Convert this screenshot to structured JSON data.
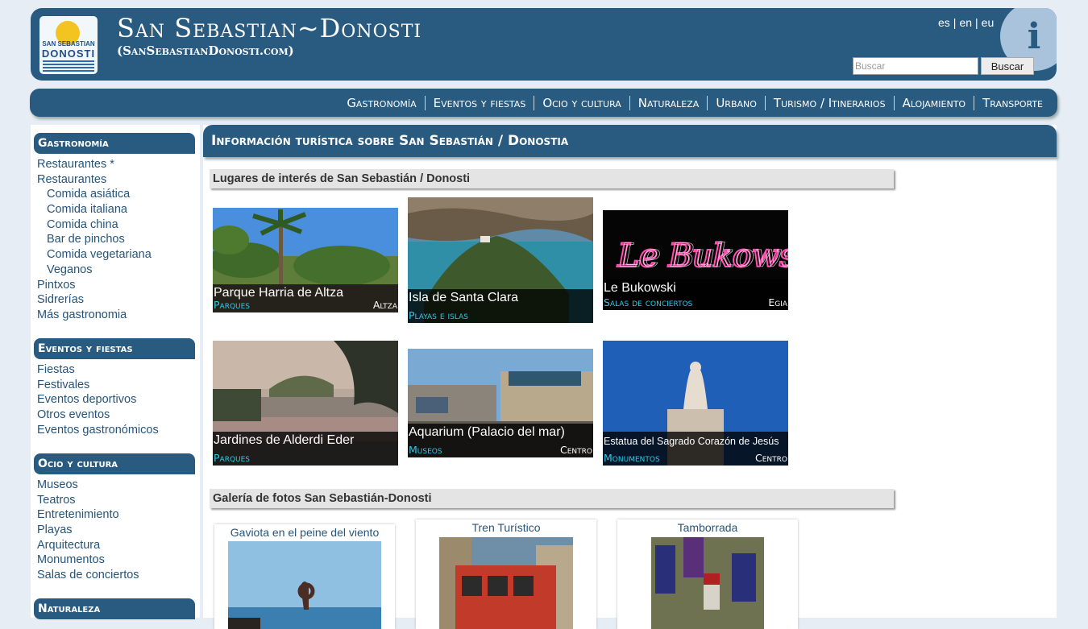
{
  "header": {
    "logo_line1": "SAN SEBASTIAN",
    "logo_line2": "DONOSTI",
    "title": "San Sebastian~Donosti",
    "subtitle": "(SanSebastianDonosti.com)",
    "languages": [
      "es",
      "en",
      "eu"
    ],
    "info_glyph": "i",
    "search_placeholder": "Buscar",
    "search_button": "Buscar"
  },
  "nav": [
    "Gastronomía",
    "Eventos y fiestas",
    "Ocio y cultura",
    "Naturaleza",
    "Urbano",
    "Turismo / Itinerarios",
    "Alojamiento",
    "Transporte"
  ],
  "sidebar": [
    {
      "title": "Gastronomía",
      "items": [
        {
          "label": "Restaurantes *",
          "sub": false
        },
        {
          "label": "Restaurantes",
          "sub": false
        },
        {
          "label": "Comida asiática",
          "sub": true
        },
        {
          "label": "Comida italiana",
          "sub": true
        },
        {
          "label": "Comida china",
          "sub": true
        },
        {
          "label": "Bar de pinchos",
          "sub": true
        },
        {
          "label": "Comida vegetariana",
          "sub": true
        },
        {
          "label": "Veganos",
          "sub": true
        },
        {
          "label": "Pintxos",
          "sub": false
        },
        {
          "label": "Sidrerías",
          "sub": false
        },
        {
          "label": "Más gastronomia",
          "sub": false
        }
      ]
    },
    {
      "title": "Eventos y fiestas",
      "items": [
        {
          "label": "Fiestas",
          "sub": false
        },
        {
          "label": "Festivales",
          "sub": false
        },
        {
          "label": "Eventos deportivos",
          "sub": false
        },
        {
          "label": "Otros eventos",
          "sub": false
        },
        {
          "label": "Eventos gastronómicos",
          "sub": false
        }
      ]
    },
    {
      "title": "Ocio y cultura",
      "items": [
        {
          "label": "Museos",
          "sub": false
        },
        {
          "label": "Teatros",
          "sub": false
        },
        {
          "label": "Entretenimiento",
          "sub": false
        },
        {
          "label": "Playas",
          "sub": false
        },
        {
          "label": "Arquitectura",
          "sub": false
        },
        {
          "label": "Monumentos",
          "sub": false
        },
        {
          "label": "Salas de conciertos",
          "sub": false
        }
      ]
    },
    {
      "title": "Naturaleza",
      "items": []
    }
  ],
  "main": {
    "heading": "Información turística sobre San Sebastián / Donostia",
    "poi_section": "Lugares de interés de San Sebastián / Donosti",
    "pois": [
      {
        "name": "Parque Harria de Altza",
        "category": "Parques",
        "zone": "Altza",
        "icon": "park-photo"
      },
      {
        "name": "Isla de Santa Clara",
        "category": "Playas e islas",
        "zone": "",
        "icon": "island-photo"
      },
      {
        "name": "Le Bukowski",
        "category": "Salas de conciertos",
        "zone": "Egia",
        "icon": "neon-sign-photo"
      },
      {
        "name": "Jardines de Alderdi Eder",
        "category": "Parques",
        "zone": "",
        "icon": "garden-photo"
      },
      {
        "name": "Aquarium (Palacio del mar)",
        "category": "Museos",
        "zone": "Centro",
        "icon": "aquarium-photo"
      },
      {
        "name": "Estatua del Sagrado Corazón de Jesús",
        "category": "Monumentos",
        "zone": "Centro",
        "icon": "statue-photo"
      }
    ],
    "poi_sign_text": "Le Bukowski",
    "gallery_section": "Galería de fotos San Sebastián-Donosti",
    "gallery": [
      {
        "title": "Gaviota en el peine del viento",
        "icon": "sculpture-photo"
      },
      {
        "title": "Tren Turístico",
        "icon": "tourist-train-photo"
      },
      {
        "title": "Tamborrada",
        "icon": "drummers-photo"
      }
    ]
  }
}
